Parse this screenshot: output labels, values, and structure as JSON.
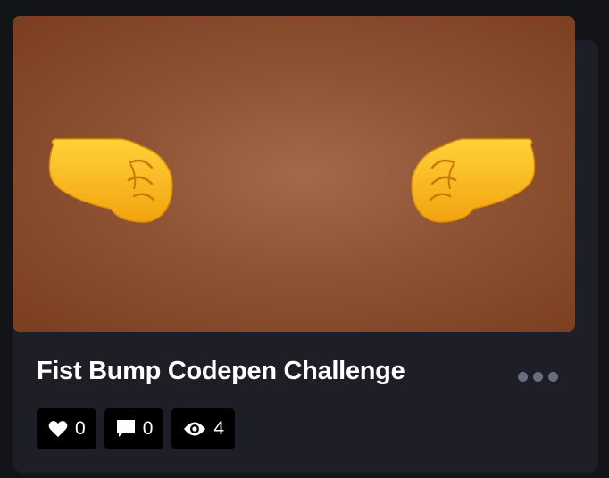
{
  "card": {
    "title": "Fist Bump Codepen Challenge",
    "preview": {
      "left_icon": "left-facing-fist-icon",
      "right_icon": "right-facing-fist-icon",
      "colors": {
        "bg_center": "#a2694a",
        "bg_edge": "#7a3e1f",
        "fist": "#ffc21a"
      }
    },
    "menu_icon": "more-options-icon",
    "stats": {
      "likes": {
        "icon": "heart-icon",
        "count": "0"
      },
      "comments": {
        "icon": "comment-icon",
        "count": "0"
      },
      "views": {
        "icon": "eye-icon",
        "count": "4"
      }
    }
  }
}
